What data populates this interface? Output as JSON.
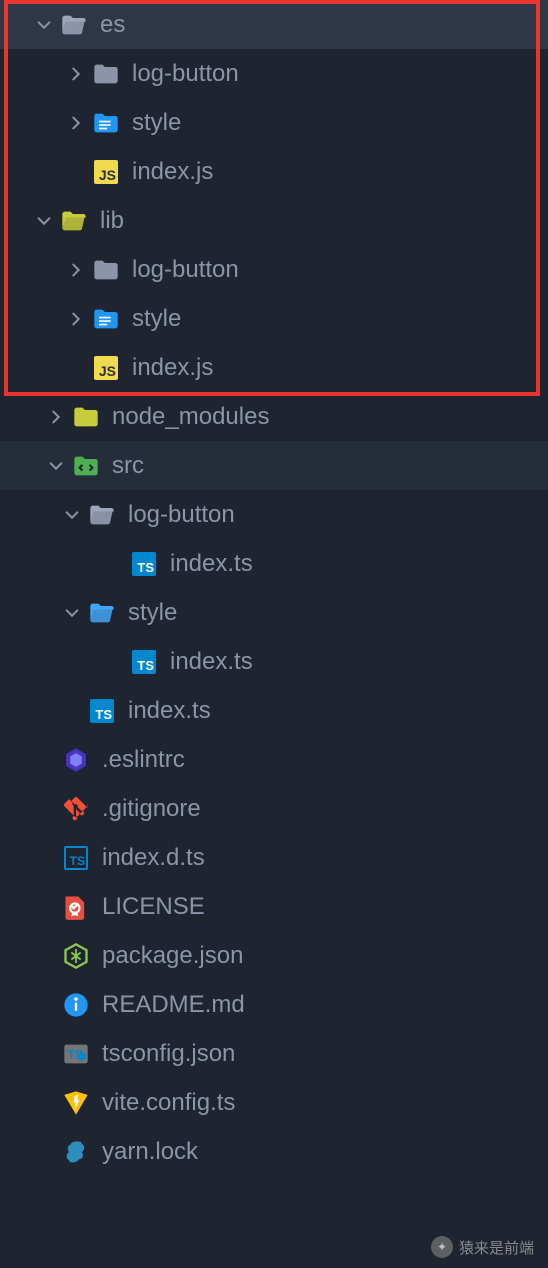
{
  "tree": {
    "es": {
      "label": "es"
    },
    "es_logbutton": {
      "label": "log-button"
    },
    "es_style": {
      "label": "style"
    },
    "es_index": {
      "label": "index.js"
    },
    "lib": {
      "label": "lib"
    },
    "lib_logbutton": {
      "label": "log-button"
    },
    "lib_style": {
      "label": "style"
    },
    "lib_index": {
      "label": "index.js"
    },
    "node_modules": {
      "label": "node_modules"
    },
    "src": {
      "label": "src"
    },
    "src_logbutton": {
      "label": "log-button"
    },
    "src_logbutton_index": {
      "label": "index.ts"
    },
    "src_style": {
      "label": "style"
    },
    "src_style_index": {
      "label": "index.ts"
    },
    "src_index": {
      "label": "index.ts"
    },
    "eslintrc": {
      "label": ".eslintrc"
    },
    "gitignore": {
      "label": ".gitignore"
    },
    "indexdts": {
      "label": "index.d.ts"
    },
    "license": {
      "label": "LICENSE"
    },
    "packagejson": {
      "label": "package.json"
    },
    "readme": {
      "label": "README.md"
    },
    "tsconfig": {
      "label": "tsconfig.json"
    },
    "viteconfig": {
      "label": "vite.config.ts"
    },
    "yarnlock": {
      "label": "yarn.lock"
    }
  },
  "watermark": {
    "text": "猿来是前端"
  }
}
